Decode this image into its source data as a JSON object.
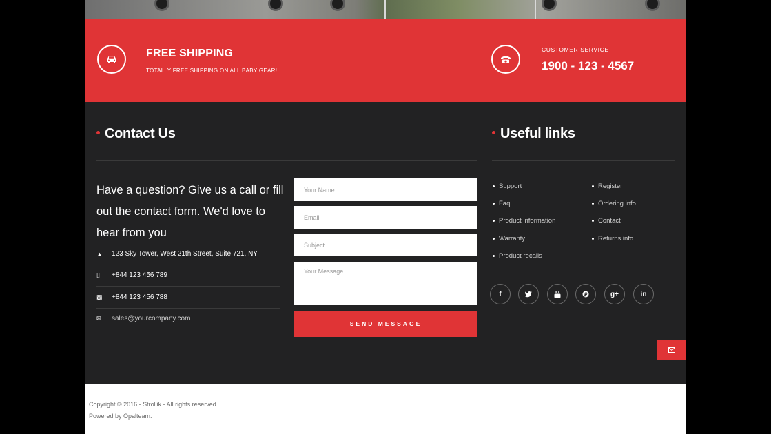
{
  "banner": {
    "shipping_title": "FREE SHIPPING",
    "shipping_subtitle": "TOTALLY FREE SHIPPING ON ALL BABY GEAR!",
    "service_label": "CUSTOMER SERVICE",
    "service_phone": "1900 - 123 - 4567",
    "shipping_icon": "car-icon",
    "service_icon": "telephone-icon"
  },
  "contact": {
    "title": "Contact Us",
    "intro": "Have a question? Give us a call or fill out the contact form. We'd love to hear from you",
    "address": "123 Sky Tower, West 21th Street, Suite 721, NY",
    "phone": "+844 123 456 789",
    "fax": "+844 123 456 788",
    "email": "sales@yourcompany.com",
    "form": {
      "name_placeholder": "Your Name",
      "email_placeholder": "Email",
      "subject_placeholder": "Subject",
      "message_placeholder": "Your Message",
      "send_label": "SEND MESSAGE"
    }
  },
  "links": {
    "title": "Useful links",
    "col1": [
      "Support",
      "Faq",
      "Product information",
      "Warranty",
      "Product recalls"
    ],
    "col2": [
      "Register",
      "Ordering info",
      "Contact",
      "Returns info"
    ]
  },
  "social": {
    "facebook": "f",
    "googleplus": "g+",
    "linkedin": "in"
  },
  "copyright": {
    "line1": "Copyright © 2016 - Strollik - All rights reserved.",
    "line2": "Powered by Opalteam."
  },
  "colors": {
    "accent": "#e03436",
    "footer_bg": "#222223"
  }
}
